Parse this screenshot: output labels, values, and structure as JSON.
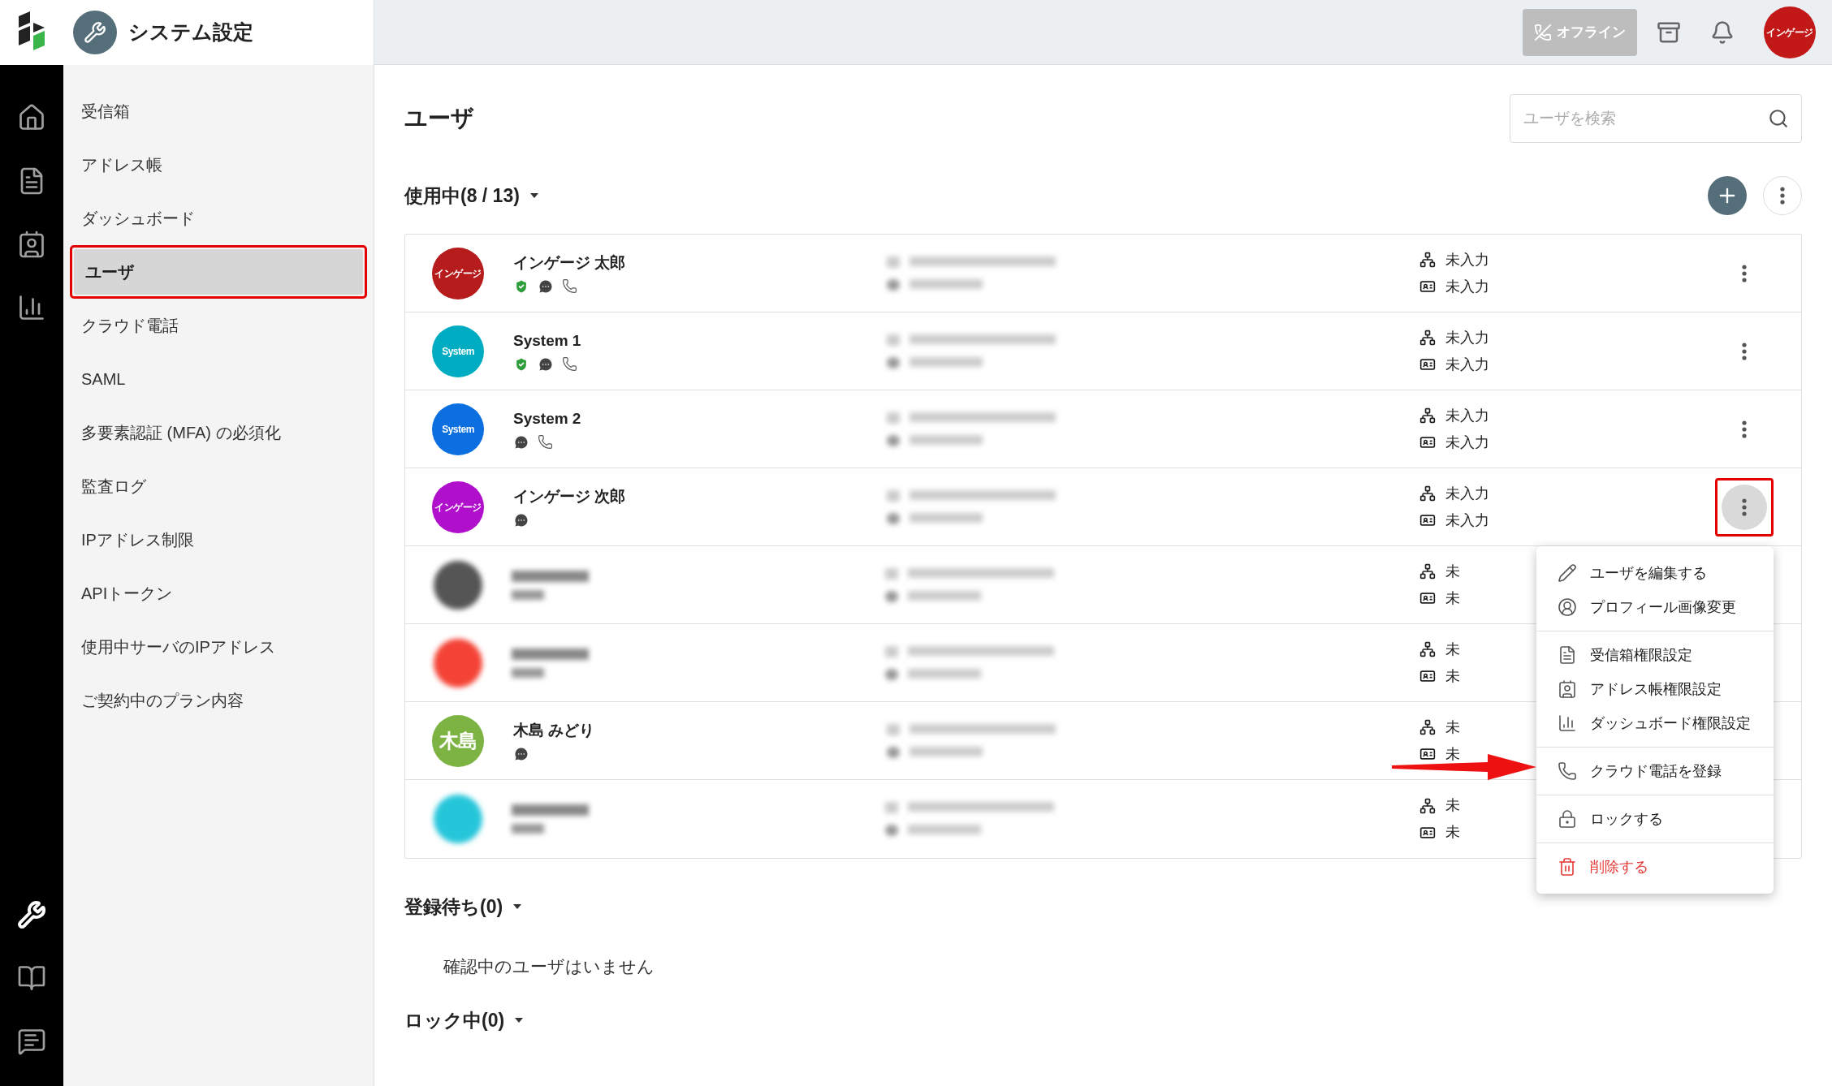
{
  "app": {
    "title": "システム設定"
  },
  "top_bar": {
    "status_button": "オフライン",
    "avatar": "インゲージ"
  },
  "rail": [
    {
      "kind": "home",
      "selected": false
    },
    {
      "kind": "inbox",
      "selected": false
    },
    {
      "kind": "contacts",
      "selected": false
    },
    {
      "kind": "dashboard",
      "selected": false
    },
    {
      "kind": "settings",
      "selected": true
    },
    {
      "kind": "manual",
      "selected": false
    },
    {
      "kind": "help",
      "selected": false
    }
  ],
  "sidebar": [
    {
      "label": "受信箱",
      "selected": false,
      "highlighted": false
    },
    {
      "label": "アドレス帳",
      "selected": false,
      "highlighted": false
    },
    {
      "label": "ダッシュボード",
      "selected": false,
      "highlighted": false
    },
    {
      "label": "ユーザ",
      "selected": true,
      "highlighted": true
    },
    {
      "label": "クラウド電話",
      "selected": false,
      "highlighted": false
    },
    {
      "label": "SAML",
      "selected": false,
      "highlighted": false
    },
    {
      "label": "多要素認証 (MFA) の必須化",
      "selected": false,
      "highlighted": false
    },
    {
      "label": "監査ログ",
      "selected": false,
      "highlighted": false
    },
    {
      "label": "IPアドレス制限",
      "selected": false,
      "highlighted": false
    },
    {
      "label": "APIトークン",
      "selected": false,
      "highlighted": false
    },
    {
      "label": "使用中サーバのIPアドレス",
      "selected": false,
      "highlighted": false
    },
    {
      "label": "ご契約中のプラン内容",
      "selected": false,
      "highlighted": false
    }
  ],
  "page": {
    "title": "ユーザ",
    "search": {
      "placeholder": "ユーザを検索"
    }
  },
  "active_section": {
    "title": "使用中(8 / 13)",
    "users": [
      {
        "kind": "visible",
        "name": "インゲージ 太郎",
        "avatar_text": "インゲージ",
        "color": "#b71c1c",
        "badges": [
          {
            "kind": "shield"
          },
          {
            "kind": "chat"
          },
          {
            "kind": "phone"
          }
        ],
        "department": "未入力",
        "employee_id": "未入力",
        "menu_open": false
      },
      {
        "kind": "visible",
        "name": "System 1",
        "avatar_text": "System",
        "color": "#00acc1",
        "badges": [
          {
            "kind": "shield"
          },
          {
            "kind": "chat"
          },
          {
            "kind": "phone"
          }
        ],
        "department": "未入力",
        "employee_id": "未入力",
        "menu_open": false
      },
      {
        "kind": "visible",
        "name": "System 2",
        "avatar_text": "System",
        "color": "#0b6fe0",
        "badges": [
          {
            "kind": "chat"
          },
          {
            "kind": "phone"
          }
        ],
        "department": "未入力",
        "employee_id": "未入力",
        "menu_open": false
      },
      {
        "kind": "visible",
        "name": "インゲージ 次郎",
        "avatar_text": "インゲージ",
        "color": "#b00fcc",
        "badges": [
          {
            "kind": "chat"
          }
        ],
        "department": "未入力",
        "employee_id": "未入力",
        "menu_open": true
      },
      {
        "kind": "blurred",
        "color": "#555555",
        "department": "未",
        "employee_id": "未"
      },
      {
        "kind": "blurred",
        "color": "#f44336",
        "department": "未",
        "employee_id": "未"
      },
      {
        "kind": "visible",
        "name": "木島 みどり",
        "avatar_text": "木島",
        "color": "#7cb342",
        "badges": [
          {
            "kind": "chat"
          }
        ],
        "department": "未",
        "employee_id": "未"
      },
      {
        "kind": "blurred",
        "color": "#26c6da",
        "department": "未",
        "employee_id": "未"
      }
    ]
  },
  "row_menu": {
    "groups": [
      [
        {
          "kind": "edit",
          "label": "ユーザを編集する"
        },
        {
          "kind": "avatar",
          "label": "プロフィール画像変更"
        }
      ],
      [
        {
          "kind": "inbox",
          "label": "受信箱権限設定"
        },
        {
          "kind": "contacts",
          "label": "アドレス帳権限設定"
        },
        {
          "kind": "dashboard",
          "label": "ダッシュボード権限設定"
        }
      ],
      [
        {
          "kind": "phone",
          "label": "クラウド電話を登録"
        }
      ],
      [
        {
          "kind": "lock",
          "label": "ロックする"
        }
      ],
      [
        {
          "kind": "delete",
          "label": "削除する"
        }
      ]
    ]
  },
  "pending_section": {
    "title": "登録待ち(0)",
    "empty_text": "確認中のユーザはいません"
  },
  "locked_section": {
    "title": "ロック中(0)"
  }
}
